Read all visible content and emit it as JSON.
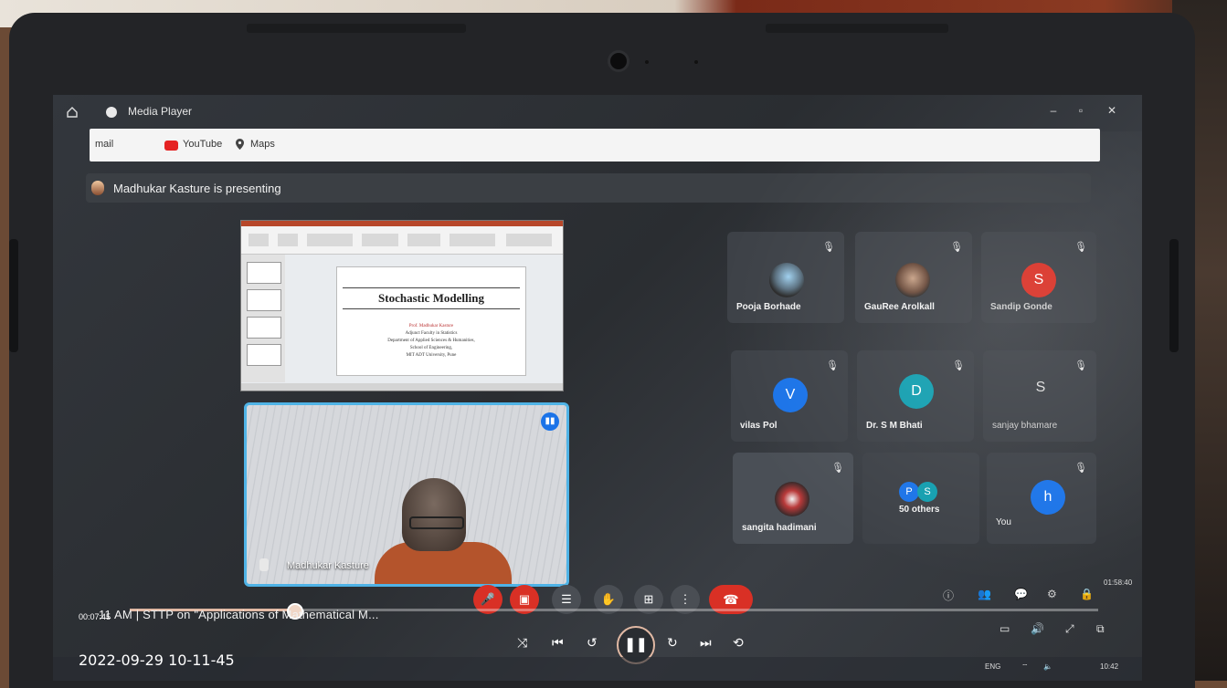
{
  "window": {
    "title": "Media Player"
  },
  "bookmarks": [
    {
      "label": "mail"
    },
    {
      "label": "YouTube"
    },
    {
      "label": "Maps"
    }
  ],
  "meet": {
    "presenting_text": "Madhukar Kasture is presenting",
    "slide": {
      "title": "Stochastic Modelling",
      "lines": [
        "Prof. Madhukar Kasture",
        "Adjunct Faculty in Statistics",
        "Department of Applied Sciences & Humanities,",
        "School of Engineering,",
        "MIT ADT University, Pune"
      ]
    },
    "presenter_tile": {
      "name": "Madhukar Kasture"
    },
    "participants": [
      {
        "name": "Pooja Borhade",
        "avatar": "photo"
      },
      {
        "name": "GauRee Arolkall",
        "avatar": "photo"
      },
      {
        "name": "Sandip Gonde",
        "initial": "S",
        "color": "#d93025"
      },
      {
        "name": "vilas Pol",
        "initial": "V",
        "color": "#1a73e8"
      },
      {
        "name": "Dr. S M Bhati",
        "initial": "D",
        "color": "#129eaf"
      },
      {
        "name": "sanjay bhamare",
        "initial": "S",
        "color": "#5f6368"
      },
      {
        "name": "sangita hadimani",
        "avatar": "photo"
      },
      {
        "name": "50 others",
        "initials": [
          "P",
          "S"
        ]
      },
      {
        "name": "You",
        "initial": "h",
        "color": "#1a73e8"
      }
    ]
  },
  "player": {
    "elapsed": "00:07:45",
    "total": "01:58:40",
    "progress": 0.17,
    "caption": "11 AM  |  STTP on \"Applications of Mathematical M..."
  },
  "timestamp": "2022-09-29 10-11-45",
  "tray": {
    "lang": "ENG",
    "time": "10:42"
  }
}
